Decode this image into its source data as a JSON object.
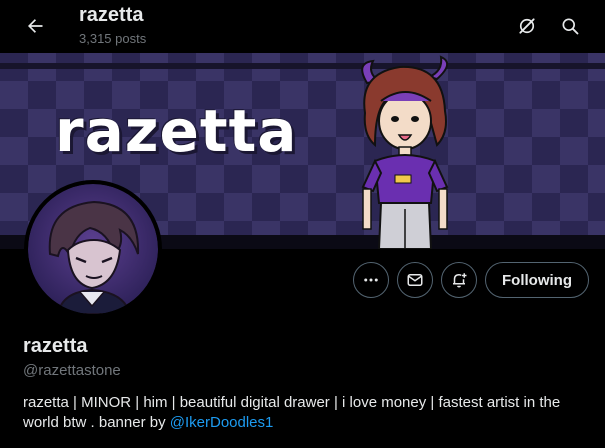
{
  "header": {
    "title": "razetta",
    "posts_count": "3,315 posts",
    "back_icon": "arrow-left-icon",
    "grok_icon": "grok-icon",
    "search_icon": "search-icon"
  },
  "banner": {
    "text": "razetta",
    "colors": {
      "dark_square": "#2b2652",
      "light_square": "#3a3466"
    }
  },
  "profile": {
    "display_name": "razetta",
    "handle": "@razettastone",
    "bio_text": "razetta | MINOR | him | beautiful digital drawer | i love money | fastest artist in the world btw . banner by ",
    "bio_mention": "@IkerDoodles1"
  },
  "actions": {
    "more_icon": "more-icon",
    "message_icon": "message-icon",
    "notify_icon": "bell-plus-icon",
    "following_label": "Following"
  },
  "theme": {
    "background": "#000000",
    "text_primary": "#e7e9ea",
    "text_secondary": "#71767b",
    "accent": "#1d9bf0",
    "border": "#536471"
  }
}
